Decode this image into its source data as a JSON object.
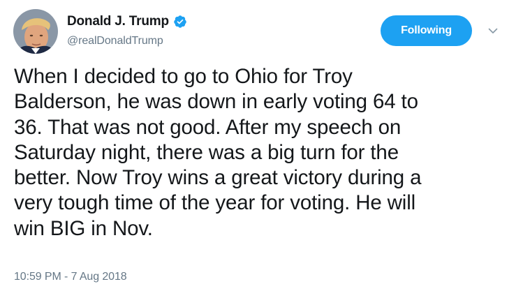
{
  "author": {
    "display_name": "Donald J. Trump",
    "handle": "@realDonaldTrump",
    "verified": true,
    "verified_icon": "verified-badge-icon",
    "avatar_icon": "profile-photo"
  },
  "actions": {
    "follow_label": "Following",
    "menu_icon": "chevron-down-icon"
  },
  "tweet": {
    "text": "When I decided to go to Ohio for Troy\nBalderson, he was down in early voting 64 to\n36. That was not good. After my speech on\nSaturday night, there was a big turn for the\nbetter. Now Troy wins a great victory during a\nvery tough time of the year for voting. He will\nwin BIG in Nov.",
    "timestamp": "10:59 PM - 7 Aug 2018"
  },
  "colors": {
    "accent": "#1da1f2",
    "text_primary": "#14171a",
    "text_secondary": "#657786",
    "background": "#ffffff"
  }
}
